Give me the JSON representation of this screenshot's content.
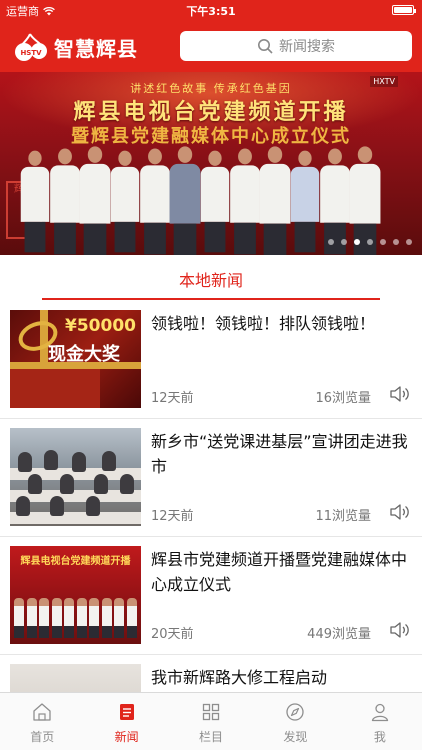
{
  "status_bar": {
    "carrier": "运营商",
    "time": "下午3:51"
  },
  "header": {
    "app_name": "智慧辉县",
    "logo_text": "HSTV",
    "search_placeholder": "新闻搜索"
  },
  "banner": {
    "line1": "讲述红色故事  传承红色基因",
    "line2": "辉县电视台党建频道开播",
    "line3": "暨辉县党建融媒体中心成立仪式",
    "seal_text": "辉县",
    "tv_logo": "HXTV",
    "dot_count": 7,
    "active_dot": 2
  },
  "section": {
    "title": "本地新闻"
  },
  "news": [
    {
      "title": "领钱啦！领钱啦！排队领钱啦！",
      "time": "12天前",
      "views": "16浏览量",
      "thumb_text_1": "¥50000",
      "thumb_text_2": "现金大奖"
    },
    {
      "title": "新乡市“送党课进基层”宣讲团走进我市",
      "time": "12天前",
      "views": "11浏览量"
    },
    {
      "title": "辉县市党建频道开播暨党建融媒体中心成立仪式",
      "time": "20天前",
      "views": "449浏览量",
      "thumb_text_1": "辉县电视台党建频道开播"
    },
    {
      "title": "我市新辉路大修工程启动"
    }
  ],
  "tabbar": [
    {
      "label": "首页",
      "icon": "home-icon",
      "active": false
    },
    {
      "label": "新闻",
      "icon": "news-icon",
      "active": true
    },
    {
      "label": "栏目",
      "icon": "grid-icon",
      "active": false
    },
    {
      "label": "发现",
      "icon": "compass-icon",
      "active": false
    },
    {
      "label": "我",
      "icon": "person-icon",
      "active": false
    }
  ],
  "colors": {
    "brand": "#e0241b",
    "tab_inactive": "#8e8e8e",
    "meta": "#777777"
  }
}
